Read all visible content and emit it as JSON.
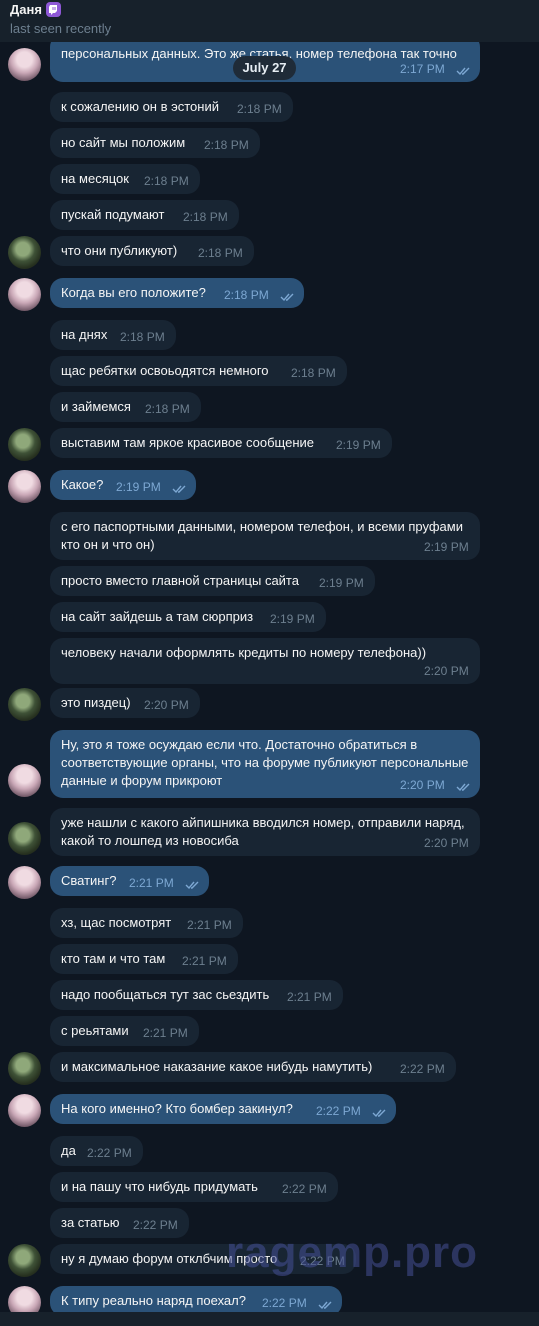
{
  "header": {
    "name": "Даня",
    "status": "last seen recently"
  },
  "date_pill": "July 27",
  "watermark": "ragemp.pro",
  "colors": {
    "incoming": "#182533",
    "outgoing": "#2b5278",
    "background": "#0e1621"
  },
  "messages": [
    {
      "text": "персональных данных. Это же статья, номер телефона так точно",
      "time": "2:17 PM",
      "out": true
    },
    {
      "text": "к сожалению он в эстоний",
      "time": "2:18 PM",
      "out": false
    },
    {
      "text": "но сайт мы положим",
      "time": "2:18 PM",
      "out": false
    },
    {
      "text": "на месяцок",
      "time": "2:18 PM",
      "out": false
    },
    {
      "text": "пускай подумают",
      "time": "2:18 PM",
      "out": false
    },
    {
      "text": "что они публикуют)",
      "time": "2:18 PM",
      "out": false
    },
    {
      "text": "Когда вы его положите?",
      "time": "2:18 PM",
      "out": true
    },
    {
      "text": "на днях",
      "time": "2:18 PM",
      "out": false
    },
    {
      "text": "щас ребятки освоьодятся немного",
      "time": "2:18 PM",
      "out": false
    },
    {
      "text": "и займемся",
      "time": "2:18 PM",
      "out": false
    },
    {
      "text": "выставим там яркое красивое сообщение",
      "time": "2:19 PM",
      "out": false
    },
    {
      "text": "Какое?",
      "time": "2:19 PM",
      "out": true
    },
    {
      "text": "с его паспортными данными, номером телефон, и всеми пруфами кто он и что он)",
      "time": "2:19 PM",
      "out": false
    },
    {
      "text": "просто вместо главной страницы сайта",
      "time": "2:19 PM",
      "out": false
    },
    {
      "text": "на сайт зайдешь а там сюрприз",
      "time": "2:19 PM",
      "out": false
    },
    {
      "text": "человеку начали оформлять кредиты по номеру телефона))",
      "time": "2:20 PM",
      "out": false
    },
    {
      "text": "это пиздец)",
      "time": "2:20 PM",
      "out": false
    },
    {
      "text": "Ну, это я тоже осуждаю если что. Достаточно обратиться в соответствующие органы, что на форуме публикуют персональные данные и форум прикроют",
      "time": "2:20 PM",
      "out": true
    },
    {
      "text": "уже нашли с какого айпишника вводился номер, отправили наряд, какой то лошпед из новосиба",
      "time": "2:20 PM",
      "out": false
    },
    {
      "text": "Сватинг?",
      "time": "2:21 PM",
      "out": true
    },
    {
      "text": "хз, щас посмотрят",
      "time": "2:21 PM",
      "out": false
    },
    {
      "text": "кто там и что там",
      "time": "2:21 PM",
      "out": false
    },
    {
      "text": "надо пообщаться тут зас сьездить",
      "time": "2:21 PM",
      "out": false
    },
    {
      "text": "с реьятами",
      "time": "2:21 PM",
      "out": false
    },
    {
      "text": "и максимальное наказание какое нибудь намутить)",
      "time": "2:22 PM",
      "out": false
    },
    {
      "text": "На кого именно? Кто бомбер закинул?",
      "time": "2:22 PM",
      "out": true
    },
    {
      "text": "да",
      "time": "2:22 PM",
      "out": false
    },
    {
      "text": "и на пашу что нибудь придумать",
      "time": "2:22 PM",
      "out": false
    },
    {
      "text": "за статью",
      "time": "2:22 PM",
      "out": false
    },
    {
      "text": "ну я думаю форум отклбчим просто",
      "time": "2:22 PM",
      "out": false
    },
    {
      "text": "К типу реально наряд поехал?",
      "time": "2:22 PM",
      "out": true
    }
  ]
}
